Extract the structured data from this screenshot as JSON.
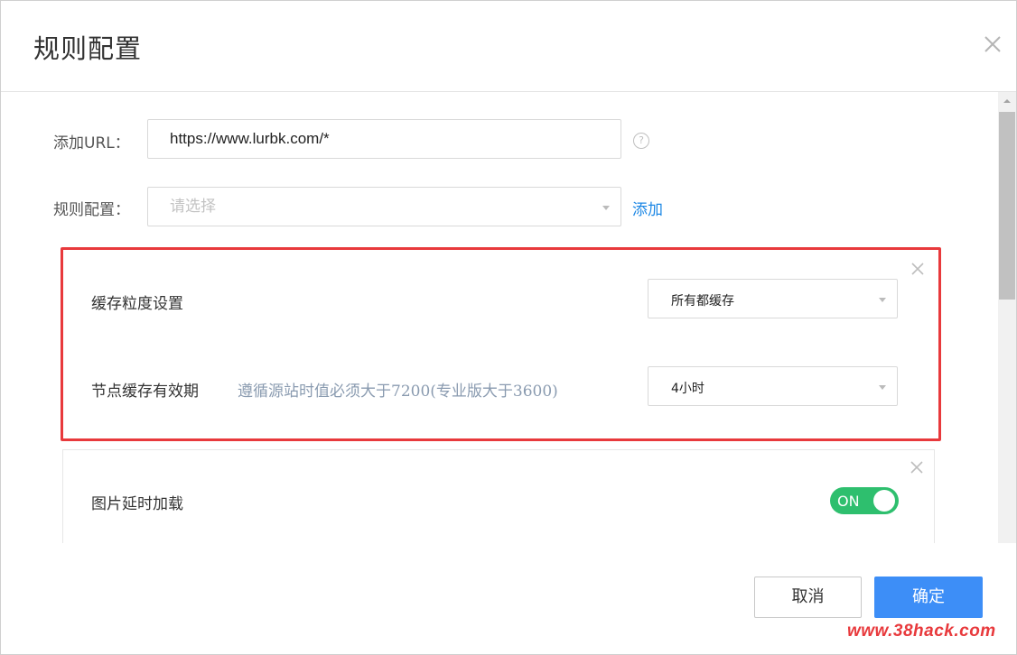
{
  "dialog": {
    "title": "规则配置",
    "close_icon": "close-icon"
  },
  "form": {
    "url": {
      "label": "添加URL：",
      "value": "https://www.lurbk.com/*",
      "help_icon": "question-circle-icon",
      "help_glyph": "?"
    },
    "rule": {
      "label": "规则配置：",
      "placeholder": "请选择",
      "add_label": "添加"
    }
  },
  "cache_card": {
    "close_icon": "close-icon",
    "granularity": {
      "label": "缓存粒度设置",
      "selected": "所有都缓存"
    },
    "ttl": {
      "label": "节点缓存有效期",
      "hint": "遵循源站时值必须大于7200(专业版大于3600)",
      "selected": "4小时"
    }
  },
  "lazy_card": {
    "close_icon": "close-icon",
    "label": "图片延时加载",
    "toggle_text": "ON",
    "enabled": true
  },
  "footer": {
    "cancel_label": "取消",
    "ok_label": "确定"
  },
  "watermark": "www.38hack.com",
  "colors": {
    "accent": "#3d8ef7",
    "link": "#1e88e5",
    "toggle_on": "#2ebf6e",
    "highlight_border": "#e8393c"
  }
}
